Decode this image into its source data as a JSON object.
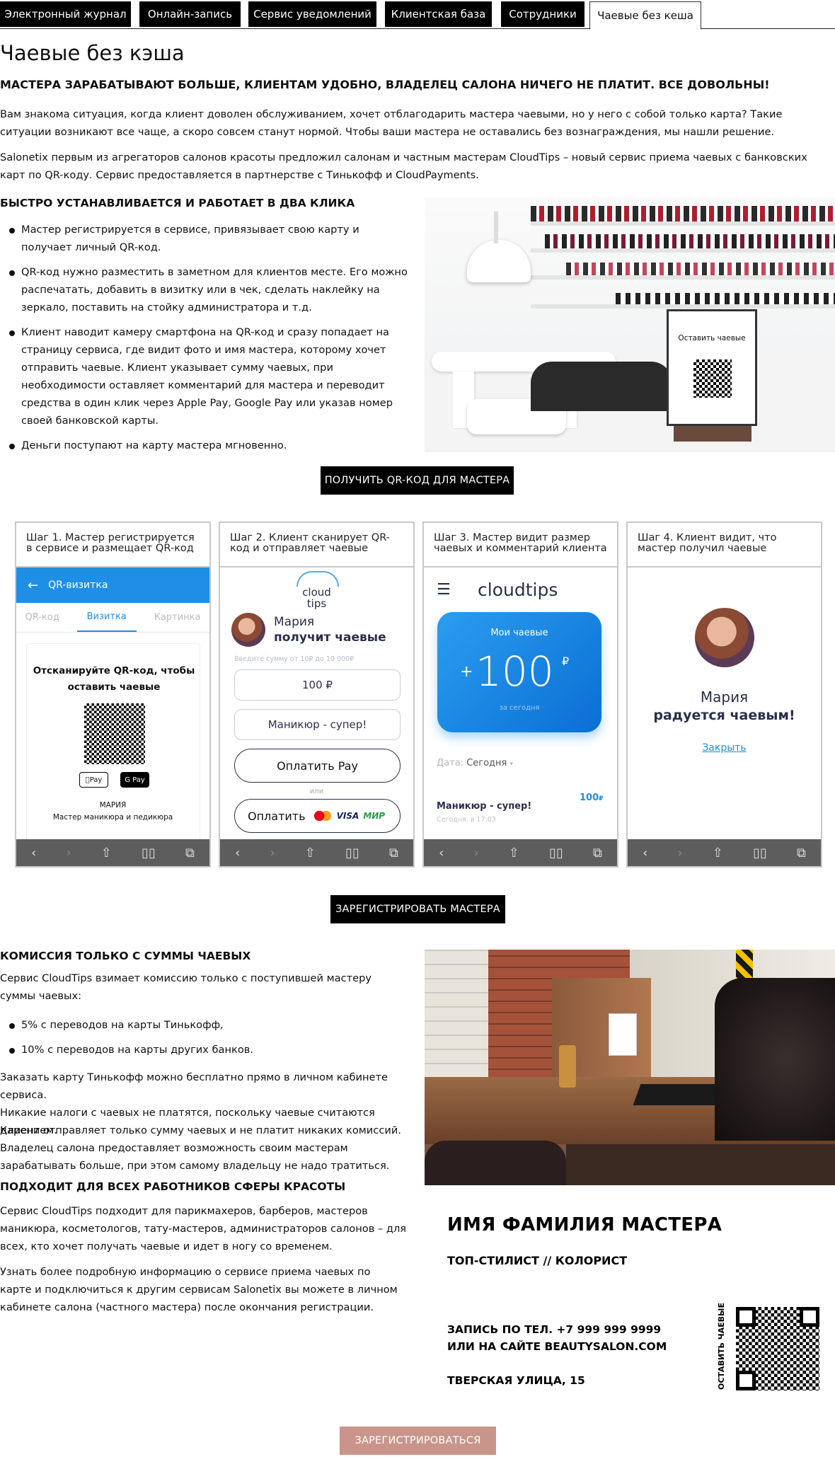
{
  "tabs": [
    {
      "label": "Электронный журнал"
    },
    {
      "label": "Онлайн-запись"
    },
    {
      "label": "Сервис уведомлений"
    },
    {
      "label": "Клиентская база"
    },
    {
      "label": "Сотрудники"
    },
    {
      "label": "Чаевые без кеша"
    }
  ],
  "page": {
    "title": "Чаевые без кэша",
    "lead": "МАСТЕРА ЗАРАБАТЫВАЮТ БОЛЬШЕ, КЛИЕНТАМ УДОБНО, ВЛАДЕЛЕЦ САЛОНА НИЧЕГО НЕ ПЛАТИТ. ВСЕ ДОВОЛЬНЫ!",
    "intro1": "Вам знакома ситуация, когда клиент доволен обслуживанием, хочет отблагодарить мастера чаевыми, но у него с собой только карта? Такие ситуации возникают все чаще, а скоро совсем станут нормой. Чтобы ваши мастера не оставались без вознаграждения, мы нашли решение.",
    "intro2": "Salonetix первым из агрегаторов салонов красоты предложил салонам и частным мастерам CloudTips – новый сервис приема чаевых с банковских карт по QR-коду. Сервис предоставляется в партнерстве с Тинькофф и CloudPayments."
  },
  "install": {
    "heading": "БЫСТРО УСТАНАВЛИВАЕТСЯ И РАБОТАЕТ В ДВА КЛИКА",
    "items": [
      "Мастер регистрируется в сервисе, привязывает свою карту и получает личный QR-код.",
      "QR-код нужно разместить в заметном для клиентов месте. Его можно распечатать, добавить в визитку или в чек, сделать наклейку на зеркало, поставить на стойку администратора и т.д.",
      "Клиент наводит камеру смартфона на QR-код и сразу попадает на страницу сервиса, где видит фото и имя мастера, которому хочет отправить чаевые. Клиент указывает сумму чаевых, при необходимости оставляет комментарий для мастера и переводит средства в один клик через Apple Pay, Google Pay или указав номер своей банковской карты.",
      "Деньги поступают на карту мастера мгновенно."
    ],
    "photo_sign": "Оставить чаевые"
  },
  "buttons": {
    "get_qr": "ПОЛУЧИТЬ QR-КОД ДЛЯ МАСТЕРА",
    "register_master": "ЗАРЕГИСТРИРОВАТЬ МАСТЕРА",
    "register": "ЗАРЕГИСТРИРОВАТЬСЯ"
  },
  "steps": {
    "s1": {
      "caption": "Шаг 1. Мастер регистрируется в сервисе и размещает QR-код",
      "header": "QR-визитка",
      "tabs": [
        "QR-код",
        "Визитка",
        "Картинка"
      ],
      "scan_text": "Отсканируйте QR-код, чтобы оставить чаевые",
      "apple_pay": "Pay",
      "google_pay": "G Pay",
      "name": "МАРИЯ",
      "role": "Мастер маникюра и педикюра"
    },
    "s2": {
      "caption": "Шаг 2. Клиент сканирует QR-код и отправляет чаевые",
      "logo_line1": "cloud",
      "logo_line2": "tips",
      "name": "Мария",
      "action": "получит чаевые",
      "hint": "Введите сумму от 10₽ до 10 000₽",
      "amount": "100 ₽",
      "comment": "Маникюр - супер!",
      "pay_apple": "Оплатить Pay",
      "or": "или",
      "pay_card": "Оплатить",
      "visa": "VISA",
      "mir": "МИР"
    },
    "s3": {
      "caption": "Шаг 3. Мастер видит размер чаевых и комментарий клиента",
      "logo": "cloudtips",
      "card_title": "Мои чаевые",
      "plus": "+",
      "amount": "100",
      "currency": "₽",
      "card_sub": "за сегодня",
      "date_label": "Дата:",
      "date_value": "Сегодня",
      "item_title": "Маникюр - супер!",
      "item_amount": "100",
      "item_currency": "₽",
      "item_time": "Сегодня, в 17:03"
    },
    "s4": {
      "caption": "Шаг 4. Клиент видит, что мастер получил чаевые",
      "name": "Мария",
      "message": "радуется чаевым!",
      "close": "Закрыть"
    }
  },
  "commission": {
    "heading": "КОМИССИЯ ТОЛЬКО С СУММЫ ЧАЕВЫХ",
    "text": "Сервис CloudTips взимает комиссию только с поступившей мастеру суммы чаевых:",
    "items": [
      "5% с переводов на карты Тинькофф,",
      "10% с переводов на карты других банков."
    ],
    "p1": "Заказать карту Тинькофф можно бесплатно прямо в личном кабинете сервиса.",
    "p2": "Никакие налоги с чаевых не платятся, поскольку чаевые считаются дарением.",
    "p3": "Клиент отправляет только сумму чаевых и не платит никаких комиссий.",
    "p4": "Владелец салона предоставляет возможность своим мастерам зарабатывать больше, при этом самому владельцу не надо тратиться."
  },
  "suitable": {
    "heading": "ПОДХОДИТ ДЛЯ ВСЕХ РАБОТНИКОВ СФЕРЫ КРАСОТЫ",
    "p1": "Сервис CloudTips подходит для парикмахеров, барберов, мастеров маникюра, косметологов, тату-мастеров, администраторов салонов – для всех, кто хочет получать чаевые и идет в ногу со временем.",
    "p2": "Узнать более подробную информацию о сервисе приема чаевых по карте и подключиться к другим сервисам Salonetix вы можете в личном кабинете салона (частного мастера) после окончания регистрации."
  },
  "business_card": {
    "name": "ИМЯ ФАМИЛИЯ МАСТЕРА",
    "role": "ТОП-СТИЛИСТ // КОЛОРИСТ",
    "phone": "ЗАПИСЬ ПО ТЕЛ. +7 999 999 9999",
    "site": "ИЛИ НА САЙТЕ BEAUTYSALON.COM",
    "address": "ТВЕРСКАЯ УЛИЦА, 15",
    "qr_label": "ОСТАВИТЬ ЧАЕВЫЕ"
  },
  "colors": {
    "accent_blue": "#1f8fe6",
    "register_btn": "#c9958a",
    "dark_text": "#2b2f4a"
  }
}
